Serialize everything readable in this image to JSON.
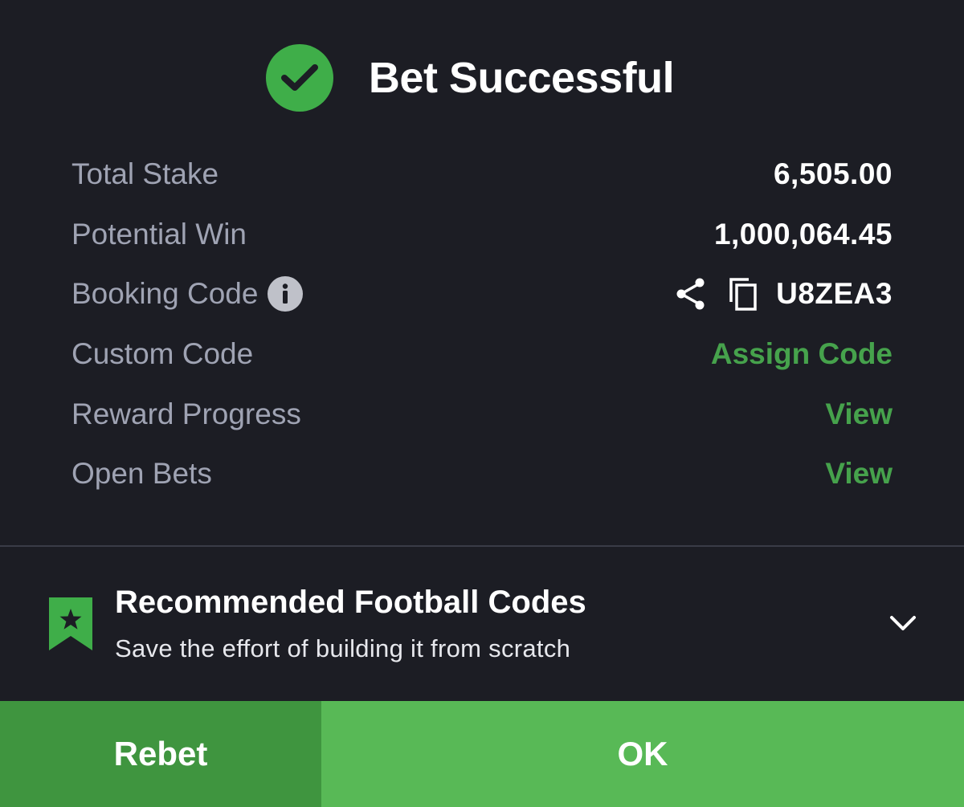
{
  "header": {
    "title": "Bet Successful",
    "icon": "check-circle-icon",
    "accent_color": "#3fae49"
  },
  "summary": {
    "total_stake": {
      "label": "Total Stake",
      "value": "6,505.00"
    },
    "potential_win": {
      "label": "Potential Win",
      "value": "1,000,064.45"
    },
    "booking_code": {
      "label": "Booking Code",
      "value": "U8ZEA3",
      "icons": [
        "info-icon",
        "share-icon",
        "copy-icon"
      ]
    },
    "custom_code": {
      "label": "Custom Code",
      "action": "Assign Code"
    },
    "reward_progress": {
      "label": "Reward Progress",
      "action": "View"
    },
    "open_bets": {
      "label": "Open Bets",
      "action": "View"
    }
  },
  "recommended": {
    "title": "Recommended Football Codes",
    "subtitle": "Save the effort of building it from scratch",
    "icon": "bookmark-star-icon",
    "toggle_icon": "chevron-down-icon"
  },
  "buttons": {
    "rebet": "Rebet",
    "ok": "OK"
  },
  "colors": {
    "background": "#1c1d24",
    "link_green": "#46a24c",
    "rebet_bg": "#3f953f",
    "ok_bg": "#58b956"
  }
}
